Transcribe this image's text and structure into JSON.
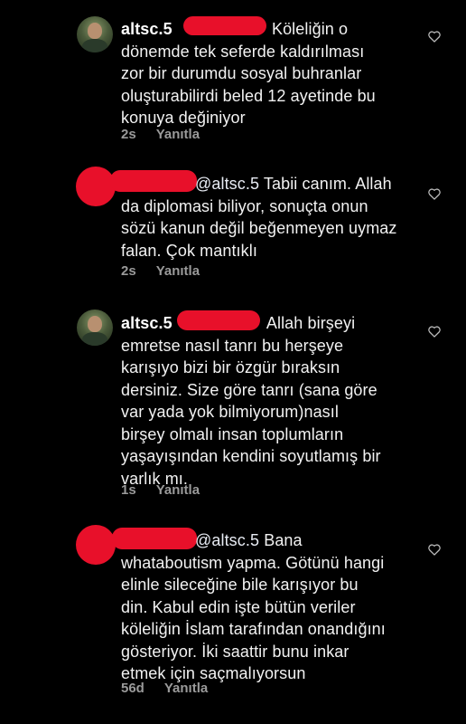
{
  "comments": [
    {
      "username": "altsc.5",
      "text": "Köleliğin o\ndönemde tek seferde kaldırılması\nzor bir durumdu sosyal buhranlar\noluşturabilirdi beled 12 ayetinde bu\nkonuya değiniyor",
      "time": "2s",
      "reply_label": "Yanıtla",
      "avatar": "profile-photo"
    },
    {
      "mention": "@altsc.5",
      "text_first": " Tabii canım. Allah",
      "text_rest": "da diplomasi biliyor, sonuçta onun\nsözü kanun değil beğenmeyen uymaz\nfalan. Çok mantıklı",
      "time": "2s",
      "reply_label": "Yanıtla",
      "avatar": "redacted"
    },
    {
      "username": "altsc.5",
      "text": " Allah birşeyi\nemretse nasıl tanrı bu herşeye\nkarışıyo bizi bir özgür bıraksın\ndersiniz. Size göre tanrı (sana göre\nvar yada yok bilmiyorum)nasıl\nbirşey olmalı insan toplumların\nyaşayışından kendini soyutlamış bir\nvarlık mı.",
      "time": "1s",
      "reply_label": "Yanıtla",
      "avatar": "profile-photo"
    },
    {
      "mention": "@altsc.5",
      "text_first": " Bana",
      "text_rest": "whataboutism yapma. Götünü hangi\nelinle sileceğine bile karışıyor bu\ndin. Kabul edin işte bütün veriler\nköleliğin İslam tarafından onandığını\ngösteriyor. İki saattir bunu inkar\netmek için saçmalıyorsun",
      "time": "56d",
      "reply_label": "Yanıtla",
      "avatar": "redacted"
    }
  ],
  "colors": {
    "background": "#000000",
    "redaction": "#e8102a",
    "meta": "#9a9a9a"
  },
  "icons": {
    "like": "heart-outline-icon"
  }
}
